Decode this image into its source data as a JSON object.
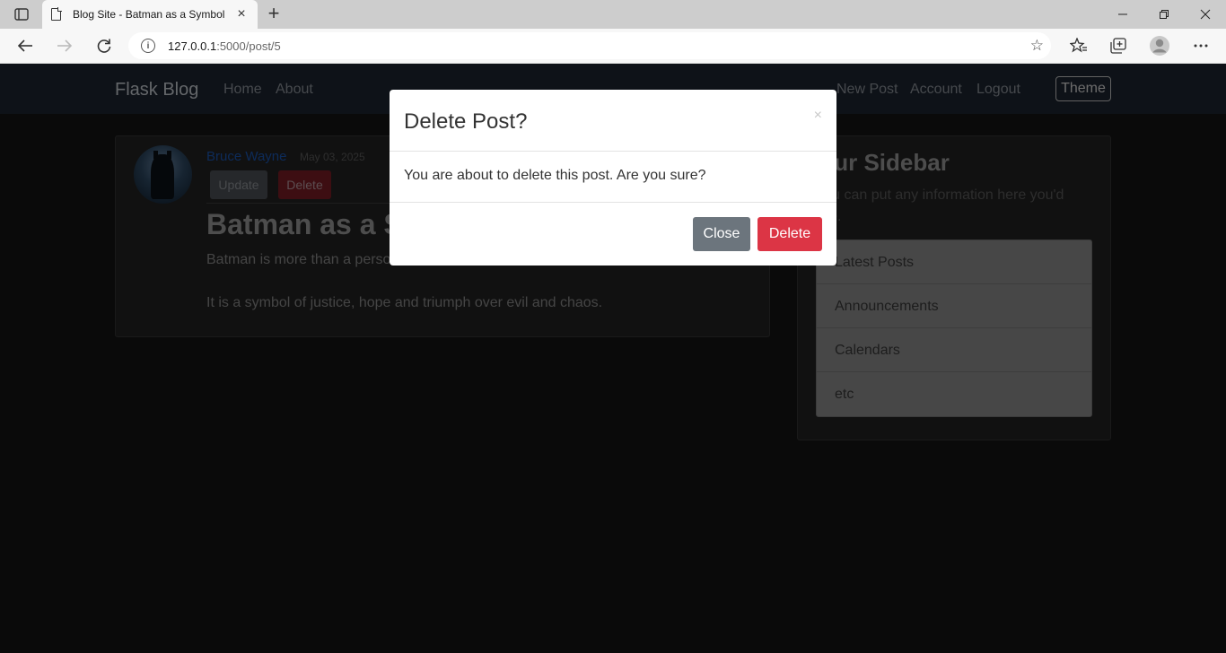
{
  "browser": {
    "tab_title": "Blog Site - Batman as a Symbol",
    "url_host": "127.0.0.1",
    "url_path": ":5000/post/5",
    "icons": [
      "tab-actions-icon",
      "document-icon",
      "close-icon",
      "plus-icon",
      "minimize-icon",
      "restore-icon",
      "close-window-icon",
      "back-icon",
      "forward-icon",
      "reload-icon",
      "info-icon",
      "favorite-add-icon",
      "favorites-icon",
      "collections-icon",
      "profile-icon",
      "more-icon"
    ]
  },
  "navbar": {
    "brand": "Flask Blog",
    "left_links": [
      "Home",
      "About"
    ],
    "right_links": [
      "New Post",
      "Account",
      "Logout"
    ],
    "theme_button": "Theme"
  },
  "post": {
    "author": "Bruce Wayne",
    "date": "May 03, 2025",
    "update_label": "Update",
    "delete_label": "Delete",
    "title": "Batman as a Symbol",
    "paragraph1": "Batman is more than a person.",
    "paragraph2": "It is a symbol of justice, hope and triumph over evil and chaos."
  },
  "sidebar": {
    "title": "Our Sidebar",
    "text": "You can put any information here you'd like.",
    "items": [
      "Latest Posts",
      "Announcements",
      "Calendars",
      "etc"
    ]
  },
  "modal": {
    "title": "Delete Post?",
    "close_x": "×",
    "body": "You are about to delete this post. Are you sure?",
    "close_label": "Close",
    "delete_label": "Delete"
  },
  "colors": {
    "navbar_bg": "#1d2531",
    "danger": "#dc3545",
    "secondary": "#6c757d",
    "author_link": "#1b56b2"
  }
}
